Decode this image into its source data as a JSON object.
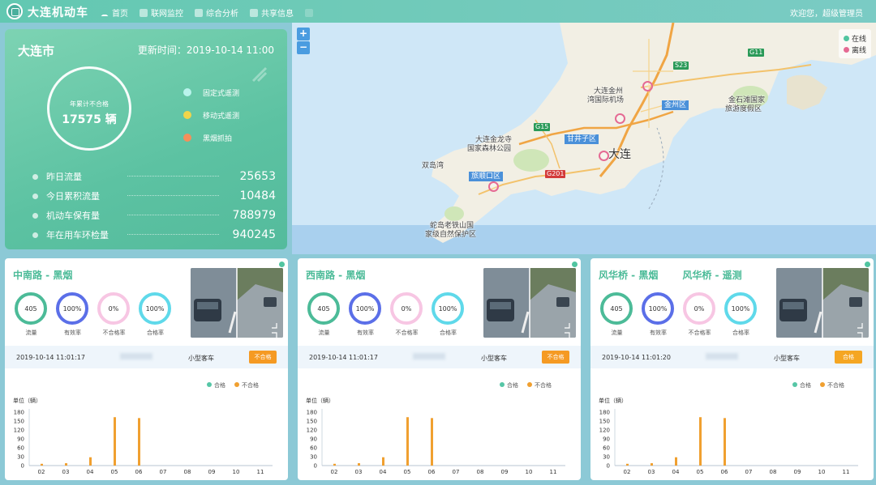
{
  "header": {
    "app_title": "大连机动车",
    "nav": [
      {
        "label": "首页",
        "icon": "home-icon"
      },
      {
        "label": "联网监控",
        "icon": "monitor-icon"
      },
      {
        "label": "综合分析",
        "icon": "analysis-icon"
      },
      {
        "label": "共享信息",
        "icon": "share-icon"
      },
      {
        "label": "",
        "icon": "more-icon"
      }
    ],
    "user": "欢迎您，超级管理员"
  },
  "summary": {
    "city": "大连市",
    "update_label": "更新时间：",
    "update_time": "2019-10-14 11:00",
    "ring_caption": "年累计不合格",
    "ring_value": "17575 辆",
    "legend": [
      {
        "label": "固定式遥测",
        "color": "#b9f3ec"
      },
      {
        "label": "移动式遥测",
        "color": "#f1d54a"
      },
      {
        "label": "黑烟抓拍",
        "color": "#f58f5a"
      }
    ],
    "stats": [
      {
        "label": "昨日流量",
        "value": "25653"
      },
      {
        "label": "今日累积流量",
        "value": "10484"
      },
      {
        "label": "机动车保有量",
        "value": "788979"
      },
      {
        "label": "年在用车环检量",
        "value": "940245"
      }
    ]
  },
  "map": {
    "zoom_in": "+",
    "zoom_out": "−",
    "legend": [
      {
        "label": "在线",
        "color": "#51c5a0"
      },
      {
        "label": "离线",
        "color": "#e56a93"
      }
    ],
    "places": [
      "大连金州",
      "湾国际机场",
      "大连金龙寺",
      "国家森林公园",
      "双岛湾",
      "蛇岛老铁山国",
      "家级自然保护区",
      "金石滩国家",
      "旅游度假区"
    ],
    "districts": [
      "金州区",
      "甘井子区",
      "旅顺口区"
    ],
    "roads": [
      "S23",
      "G11",
      "G15",
      "G201"
    ],
    "city_label": "大连"
  },
  "stations": [
    {
      "titles": [
        "中南路 - 黑烟"
      ],
      "metrics": [
        {
          "value": "405",
          "label": "流量",
          "color": "#4cbb98"
        },
        {
          "value": "100%",
          "label": "有效率",
          "color": "#5b6fe8"
        },
        {
          "value": "0%",
          "label": "不合格率",
          "color": "#f7c6e3"
        },
        {
          "value": "100%",
          "label": "合格率",
          "color": "#5fd9ea"
        }
      ],
      "record": {
        "time": "2019-10-14 11:01:17",
        "type": "小型客车",
        "result": "不合格"
      },
      "chart_data": {
        "type": "bar",
        "ylabel": "单位（辆）",
        "categories": [
          "02",
          "03",
          "04",
          "05",
          "06",
          "07",
          "08",
          "09",
          "10",
          "11"
        ],
        "yticks": [
          0,
          30,
          60,
          90,
          120,
          150,
          180
        ],
        "ylim": [
          0,
          180
        ],
        "legend_position": "top-right",
        "series": [
          {
            "name": "合格",
            "color": "#56c6a6",
            "values": [
              0,
              0,
              0,
              0,
              0,
              0,
              0,
              0,
              0,
              0
            ]
          },
          {
            "name": "不合格",
            "color": "#f0a030",
            "values": [
              6,
              8,
              28,
              163,
              160,
              0,
              0,
              0,
              0,
              0
            ]
          }
        ]
      }
    },
    {
      "titles": [
        "西南路 - 黑烟"
      ],
      "metrics": [
        {
          "value": "405",
          "label": "流量",
          "color": "#4cbb98"
        },
        {
          "value": "100%",
          "label": "有效率",
          "color": "#5b6fe8"
        },
        {
          "value": "0%",
          "label": "不合格率",
          "color": "#f7c6e3"
        },
        {
          "value": "100%",
          "label": "合格率",
          "color": "#5fd9ea"
        }
      ],
      "record": {
        "time": "2019-10-14 11:01:17",
        "type": "小型客车",
        "result": "不合格"
      },
      "chart_data": {
        "type": "bar",
        "ylabel": "单位（辆）",
        "categories": [
          "02",
          "03",
          "04",
          "05",
          "06",
          "07",
          "08",
          "09",
          "10",
          "11"
        ],
        "yticks": [
          0,
          30,
          60,
          90,
          120,
          150,
          180
        ],
        "ylim": [
          0,
          180
        ],
        "legend_position": "top-right",
        "series": [
          {
            "name": "合格",
            "color": "#56c6a6",
            "values": [
              0,
              0,
              0,
              0,
              0,
              0,
              0,
              0,
              0,
              0
            ]
          },
          {
            "name": "不合格",
            "color": "#f0a030",
            "values": [
              6,
              8,
              28,
              163,
              160,
              0,
              0,
              0,
              0,
              0
            ]
          }
        ]
      }
    },
    {
      "titles": [
        "风华桥 - 黑烟",
        "风华桥 - 遥测"
      ],
      "metrics": [
        {
          "value": "405",
          "label": "流量",
          "color": "#4cbb98"
        },
        {
          "value": "100%",
          "label": "有效率",
          "color": "#5b6fe8"
        },
        {
          "value": "0%",
          "label": "不合格率",
          "color": "#f7c6e3"
        },
        {
          "value": "100%",
          "label": "合格率",
          "color": "#5fd9ea"
        }
      ],
      "record": {
        "time": "2019-10-14 11:01:20",
        "type": "小型客车",
        "result": "合格"
      },
      "chart_data": {
        "type": "bar",
        "ylabel": "单位（辆）",
        "categories": [
          "02",
          "03",
          "04",
          "05",
          "06",
          "07",
          "08",
          "09",
          "10",
          "11"
        ],
        "yticks": [
          0,
          30,
          60,
          90,
          120,
          150,
          180
        ],
        "ylim": [
          0,
          180
        ],
        "legend_position": "top-right",
        "series": [
          {
            "name": "合格",
            "color": "#56c6a6",
            "values": [
              0,
              0,
              0,
              0,
              0,
              0,
              0,
              0,
              0,
              0
            ]
          },
          {
            "name": "不合格",
            "color": "#f0a030",
            "values": [
              6,
              8,
              28,
              163,
              160,
              0,
              0,
              0,
              0,
              0
            ]
          }
        ]
      }
    }
  ]
}
